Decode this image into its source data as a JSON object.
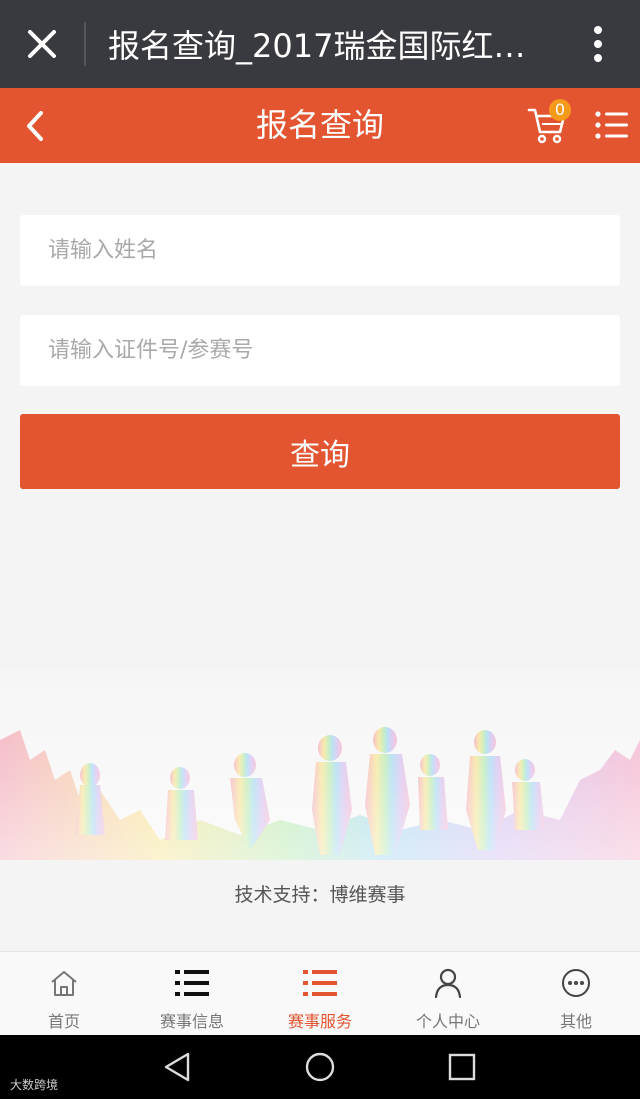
{
  "browser": {
    "title": "报名查询_2017瑞金国际红色…",
    "close_icon": "close-icon",
    "more_icon": "more-vertical-icon"
  },
  "header": {
    "title": "报名查询",
    "back_icon": "chevron-left-icon",
    "cart_icon": "cart-icon",
    "cart_count": "0",
    "menu_icon": "menu-list-icon",
    "color": "#e25530"
  },
  "form": {
    "name_placeholder": "请输入姓名",
    "name_value": "",
    "id_placeholder": "请输入证件号/参赛号",
    "id_value": "",
    "submit_label": "查询"
  },
  "footer": {
    "support_text": "技术支持：博维赛事"
  },
  "tabs": [
    {
      "label": "首页",
      "icon": "home-icon",
      "active": false
    },
    {
      "label": "赛事信息",
      "icon": "list-icon",
      "active": false
    },
    {
      "label": "赛事服务",
      "icon": "list-icon",
      "active": true
    },
    {
      "label": "个人中心",
      "icon": "user-icon",
      "active": false
    },
    {
      "label": "其他",
      "icon": "more-circle-icon",
      "active": false
    }
  ],
  "system_nav": {
    "back_icon": "triangle-back-icon",
    "home_icon": "circle-home-icon",
    "recents_icon": "square-recents-icon"
  },
  "watermark": "大数跨境",
  "colors": {
    "accent": "#e25530",
    "browser_bar": "#393a3f",
    "badge": "#f59a1b"
  }
}
